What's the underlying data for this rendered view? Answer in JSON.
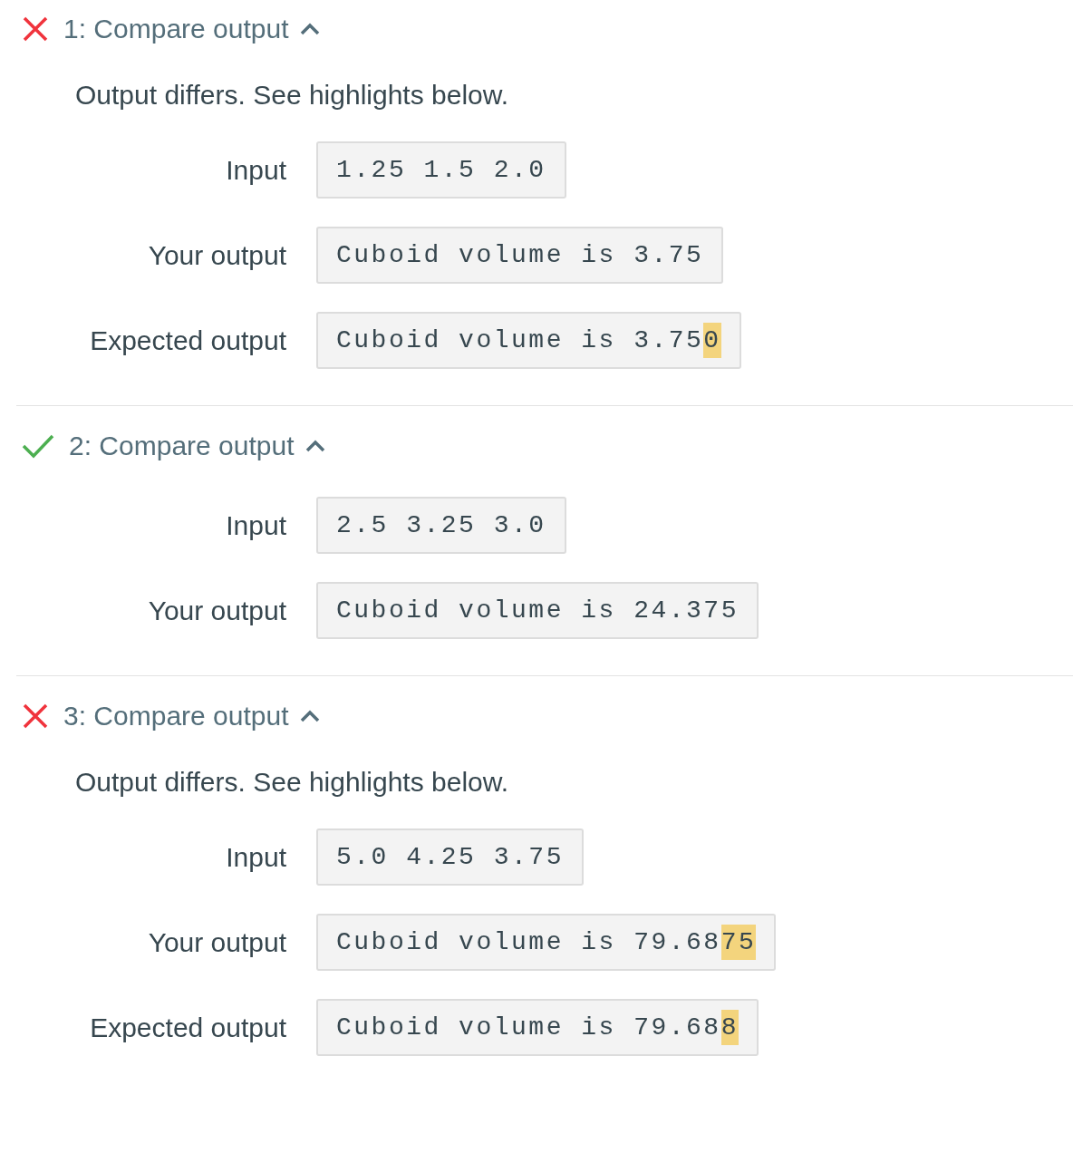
{
  "tests": [
    {
      "kind": "fail",
      "title": "1: Compare output",
      "expanded": true,
      "message": "Output differs. See highlights below.",
      "rows": [
        {
          "label": "Input",
          "segments": [
            {
              "text": "1.25 1.5 2.0",
              "highlighted": false
            }
          ]
        },
        {
          "label": "Your output",
          "segments": [
            {
              "text": "Cuboid volume is 3.75",
              "highlighted": false
            }
          ]
        },
        {
          "label": "Expected output",
          "segments": [
            {
              "text": "Cuboid volume is 3.75",
              "highlighted": false
            },
            {
              "text": "0",
              "highlighted": true
            }
          ]
        }
      ]
    },
    {
      "kind": "pass",
      "title": "2: Compare output",
      "expanded": true,
      "rows": [
        {
          "label": "Input",
          "segments": [
            {
              "text": "2.5 3.25 3.0",
              "highlighted": false
            }
          ]
        },
        {
          "label": "Your output",
          "segments": [
            {
              "text": "Cuboid volume is 24.375",
              "highlighted": false
            }
          ]
        }
      ]
    },
    {
      "kind": "fail",
      "title": "3: Compare output",
      "expanded": true,
      "message": "Output differs. See highlights below.",
      "rows": [
        {
          "label": "Input",
          "segments": [
            {
              "text": "5.0 4.25 3.75",
              "highlighted": false
            }
          ]
        },
        {
          "label": "Your output",
          "segments": [
            {
              "text": "Cuboid volume is 79.68",
              "highlighted": false
            },
            {
              "text": "75",
              "highlighted": true
            }
          ]
        },
        {
          "label": "Expected output",
          "segments": [
            {
              "text": "Cuboid volume is 79.68",
              "highlighted": false
            },
            {
              "text": "8",
              "highlighted": true
            }
          ]
        }
      ]
    }
  ]
}
